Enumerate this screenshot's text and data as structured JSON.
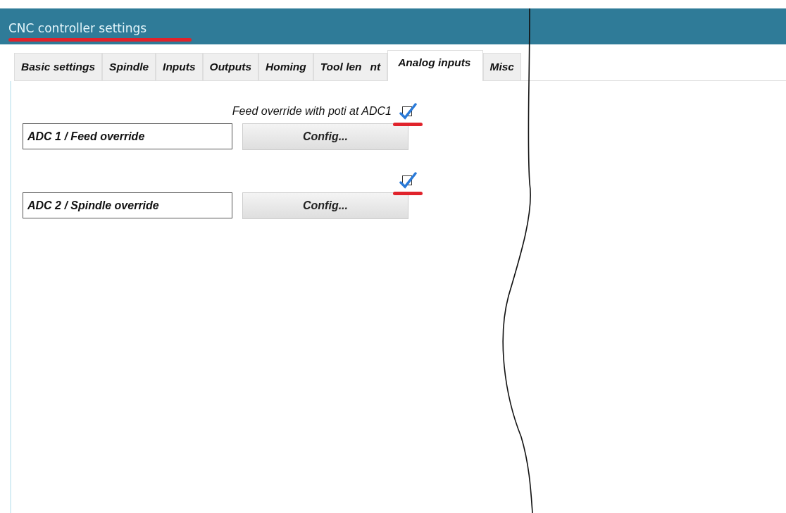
{
  "window": {
    "title": "CNC controller settings"
  },
  "tabs": [
    {
      "label_parts": [
        "Basic settings"
      ],
      "selected": false
    },
    {
      "label_parts": [
        "Spindle"
      ],
      "selected": false
    },
    {
      "label_parts": [
        "Inputs"
      ],
      "selected": false
    },
    {
      "label_parts": [
        "Outputs"
      ],
      "selected": false
    },
    {
      "label_parts": [
        "Homing"
      ],
      "selected": false
    },
    {
      "label_parts": [
        "Tool len",
        "nt"
      ],
      "selected": false
    },
    {
      "label_parts": [
        "Analog inputs"
      ],
      "selected": true
    },
    {
      "label_parts": [
        "Misc"
      ],
      "selected": false
    }
  ],
  "adc_channels": [
    {
      "checkbox_label": "Feed override with poti at ADC1",
      "checked": true,
      "name_parts": [
        "ADC ",
        "1",
        " / Feed override"
      ],
      "button": "Config..."
    },
    {
      "checked": true,
      "name_parts": [
        "ADC ",
        "2",
        " / Spindle override"
      ],
      "button": "Config..."
    }
  ]
}
